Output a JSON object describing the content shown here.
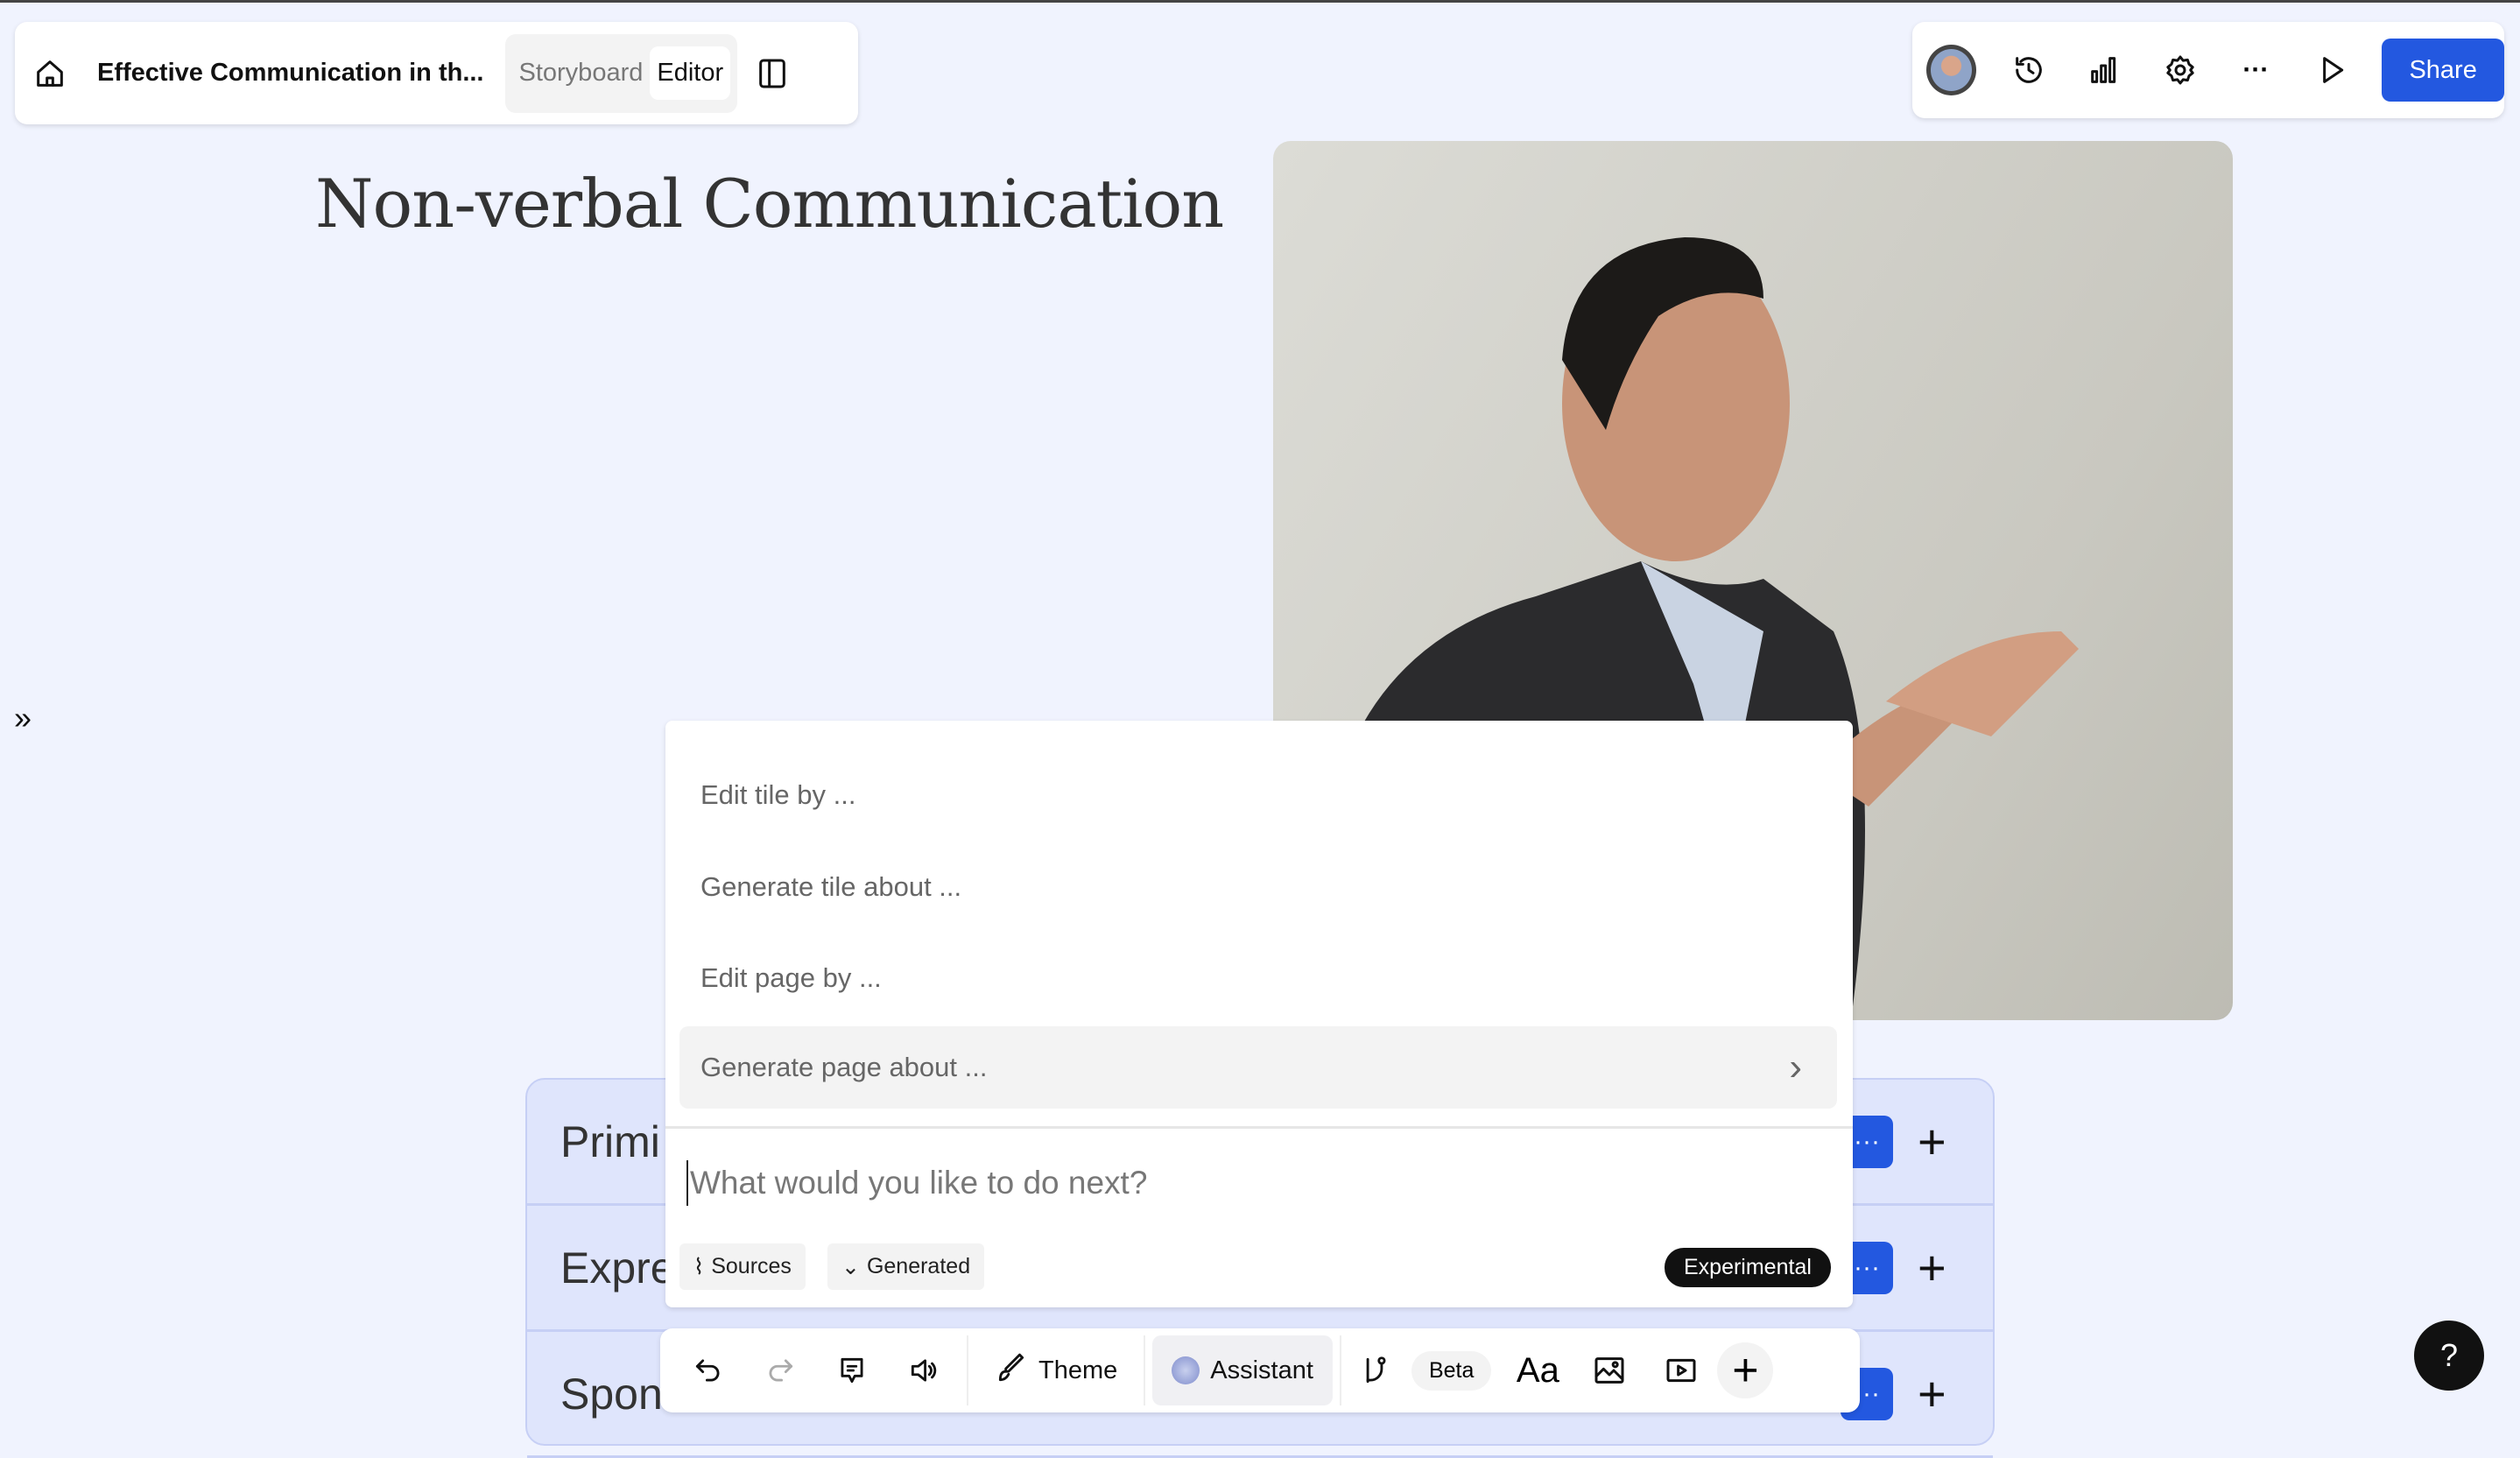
{
  "header": {
    "title": "Effective Communication in th...",
    "view_tabs": [
      "Storyboard",
      "Editor"
    ],
    "active_tab": "Editor"
  },
  "top_actions": {
    "share_label": "Share"
  },
  "page": {
    "title": "Non-verbal Communication"
  },
  "rows": [
    {
      "label": "Primi"
    },
    {
      "label": "Expre"
    },
    {
      "label": "Spon"
    }
  ],
  "assistant_menu": {
    "items": [
      "Edit tile by ...",
      "Generate tile about ...",
      "Edit page by ...",
      "Generate page about ..."
    ],
    "prompt_placeholder": "What would you like to do next?",
    "sources_label": "Sources",
    "generated_label": "Generated",
    "experimental_label": "Experimental"
  },
  "toolbar": {
    "theme_label": "Theme",
    "assistant_label": "Assistant",
    "beta_label": "Beta",
    "text_label": "Aa"
  },
  "help_label": "?",
  "colors": {
    "accent": "#2358e0",
    "background": "#f0f3fe"
  }
}
